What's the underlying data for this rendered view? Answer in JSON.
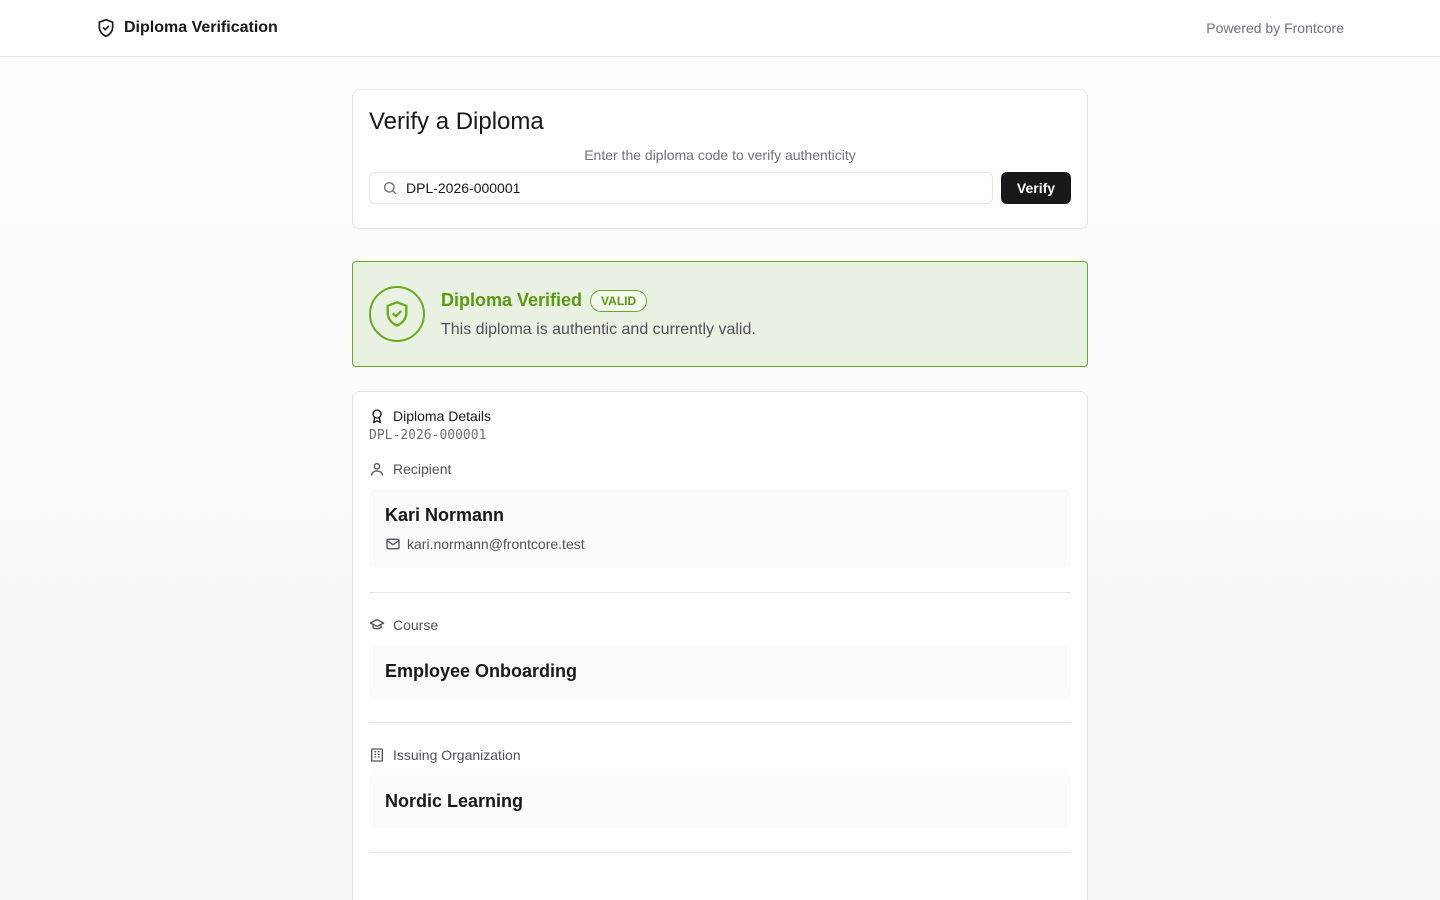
{
  "header": {
    "title": "Diploma Verification",
    "powered_by": "Powered by Frontcore"
  },
  "verify": {
    "title": "Verify a Diploma",
    "subtitle": "Enter the diploma code to verify authenticity",
    "input_value": "DPL-2026-000001",
    "button_label": "Verify"
  },
  "status": {
    "title": "Diploma Verified",
    "badge": "VALID",
    "description": "This diploma is authentic and currently valid.",
    "accent_color": "#6aaa1f"
  },
  "details": {
    "heading": "Diploma Details",
    "code": "DPL-2026-000001",
    "recipient": {
      "label": "Recipient",
      "name": "Kari Normann",
      "email": "kari.normann@frontcore.test"
    },
    "course": {
      "label": "Course",
      "name": "Employee Onboarding"
    },
    "organization": {
      "label": "Issuing Organization",
      "name": "Nordic Learning"
    }
  }
}
